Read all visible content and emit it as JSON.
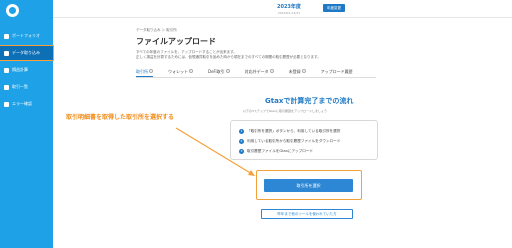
{
  "header": {
    "year_label": "2023年度",
    "year_sub": "2023/01-12/31",
    "change_label": "年度変更"
  },
  "sidebar": {
    "items": [
      {
        "label": "ポートフォリオ"
      },
      {
        "label": "データ取り込み"
      },
      {
        "label": "損益計算"
      },
      {
        "label": "取引一覧"
      },
      {
        "label": "エラー確認"
      }
    ]
  },
  "main": {
    "breadcrumb": "データ取り込み ＞ 取引所",
    "title": "ファイルアップロード",
    "desc1": "すべての年度のファイルを、アップロードすることが出来ます。",
    "desc2": "正しく損益を計算するためには、仮想通貨取引を始めた時から現在までのすべての期間の取引履歴が必要となります。",
    "tabs": [
      {
        "label": "取引所"
      },
      {
        "label": "ウォレット"
      },
      {
        "label": "DeFi取引"
      },
      {
        "label": "対応外データ"
      },
      {
        "label": "未登録"
      },
      {
        "label": "アップロード履歴"
      }
    ],
    "flow_title": "Gtaxで計算完了までの流れ",
    "flow_sub": "以下の3ステップでGtaxに取引履歴をアップロードしましょう",
    "steps": [
      {
        "num": "1",
        "text": "「取引所を選択」ボタンから、利用している取引所を選択"
      },
      {
        "num": "2",
        "text": "利用している取引所から取引履歴ファイルをダウンロード"
      },
      {
        "num": "3",
        "text": "取引履歴ファイルをGtaxにアップロード"
      }
    ],
    "select_button": "取引所を選択",
    "oldtool_button": "昨年まで他のツールを使われていた方"
  },
  "annotation": {
    "text": "取引明細書を取得した取引所を選択する",
    "color": "#f08c1a"
  },
  "colors": {
    "sidebar": "#1ea1e6",
    "accent": "#1f79c4",
    "highlight": "#f3a13a"
  }
}
